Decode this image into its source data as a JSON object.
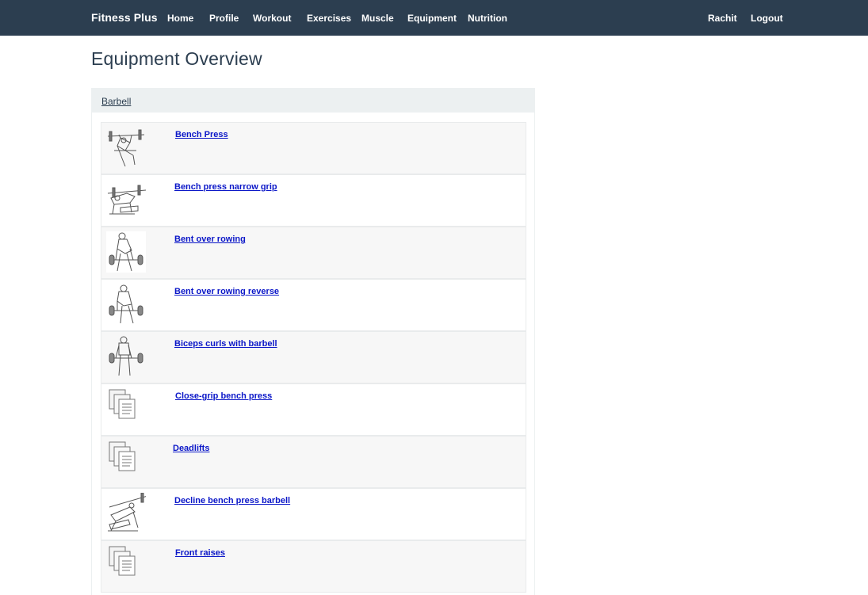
{
  "navbar": {
    "brand": "Fitness Plus",
    "items": [
      {
        "label": "Home"
      },
      {
        "label": "Profile"
      },
      {
        "label": "Workout"
      },
      {
        "label": "Exercises"
      },
      {
        "label": "Muscle"
      },
      {
        "label": "Equipment"
      },
      {
        "label": "Nutrition"
      }
    ],
    "user": "Rachit",
    "logout": "Logout"
  },
  "page": {
    "title": "Equipment Overview"
  },
  "panel": {
    "heading": "Barbell",
    "exercises": [
      {
        "name": "Bench Press",
        "thumbnail": "bench-press-figure"
      },
      {
        "name": "Bench press narrow grip",
        "thumbnail": "bench-press-figure"
      },
      {
        "name": "Bent over rowing",
        "thumbnail": "standing-figure"
      },
      {
        "name": "Bent over rowing reverse",
        "thumbnail": "standing-figure"
      },
      {
        "name": "Biceps curls with barbell",
        "thumbnail": "standing-figure"
      },
      {
        "name": "Close-grip bench press",
        "thumbnail": "placeholder-document"
      },
      {
        "name": "Deadlifts",
        "thumbnail": "placeholder-document"
      },
      {
        "name": "Decline bench press barbell",
        "thumbnail": "bench-press-figure"
      },
      {
        "name": "Front raises",
        "thumbnail": "placeholder-document"
      }
    ]
  }
}
